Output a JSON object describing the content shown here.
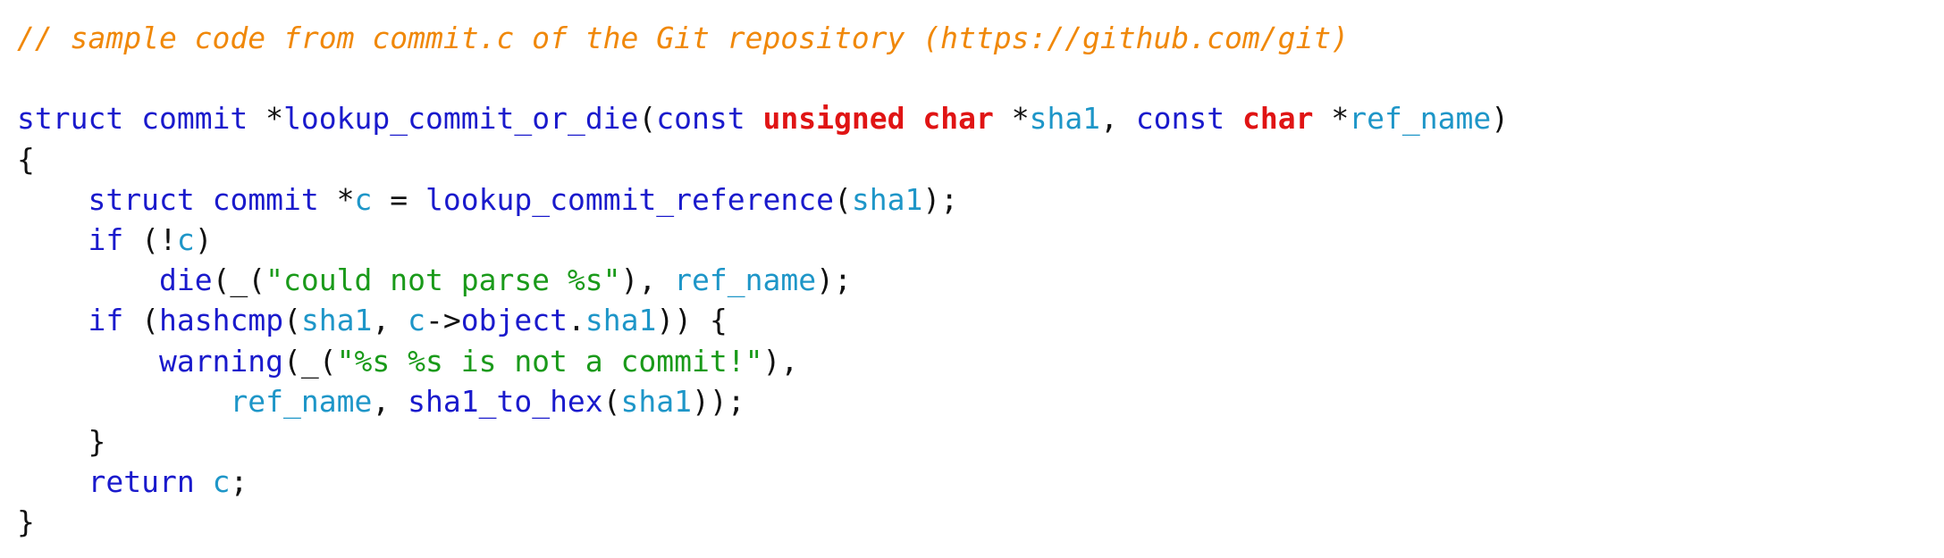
{
  "colors": {
    "comment": "#f0880a",
    "keyword": "#1a1acc",
    "type": "#e01414",
    "identifier": "#1e96c8",
    "string": "#1a9a1a",
    "plain": "#111111"
  },
  "lines": [
    [
      {
        "t": "// sample code from commit.c of the Git repository (https://github.com/git)",
        "c": "comment"
      }
    ],
    [],
    [
      {
        "t": "struct",
        "c": "keyword"
      },
      {
        "t": " "
      },
      {
        "t": "commit",
        "c": "keyword"
      },
      {
        "t": " *"
      },
      {
        "t": "lookup_commit_or_die",
        "c": "keyword"
      },
      {
        "t": "("
      },
      {
        "t": "const",
        "c": "keyword"
      },
      {
        "t": " "
      },
      {
        "t": "unsigned",
        "c": "type"
      },
      {
        "t": " "
      },
      {
        "t": "char",
        "c": "type"
      },
      {
        "t": " *"
      },
      {
        "t": "sha1",
        "c": "identifier"
      },
      {
        "t": ", "
      },
      {
        "t": "const",
        "c": "keyword"
      },
      {
        "t": " "
      },
      {
        "t": "char",
        "c": "type"
      },
      {
        "t": " *"
      },
      {
        "t": "ref_name",
        "c": "identifier"
      },
      {
        "t": ")"
      }
    ],
    [
      {
        "t": "{"
      }
    ],
    [
      {
        "t": "    "
      },
      {
        "t": "struct",
        "c": "keyword"
      },
      {
        "t": " "
      },
      {
        "t": "commit",
        "c": "keyword"
      },
      {
        "t": " *"
      },
      {
        "t": "c",
        "c": "identifier"
      },
      {
        "t": " = "
      },
      {
        "t": "lookup_commit_reference",
        "c": "keyword"
      },
      {
        "t": "("
      },
      {
        "t": "sha1",
        "c": "identifier"
      },
      {
        "t": ");"
      }
    ],
    [
      {
        "t": "    "
      },
      {
        "t": "if",
        "c": "keyword"
      },
      {
        "t": " (!"
      },
      {
        "t": "c",
        "c": "identifier"
      },
      {
        "t": ")"
      }
    ],
    [
      {
        "t": "        "
      },
      {
        "t": "die",
        "c": "keyword"
      },
      {
        "t": "(_("
      },
      {
        "t": "\"could not parse %s\"",
        "c": "string"
      },
      {
        "t": "), "
      },
      {
        "t": "ref_name",
        "c": "identifier"
      },
      {
        "t": ");"
      }
    ],
    [
      {
        "t": "    "
      },
      {
        "t": "if",
        "c": "keyword"
      },
      {
        "t": " ("
      },
      {
        "t": "hashcmp",
        "c": "keyword"
      },
      {
        "t": "("
      },
      {
        "t": "sha1",
        "c": "identifier"
      },
      {
        "t": ", "
      },
      {
        "t": "c",
        "c": "identifier"
      },
      {
        "t": "->"
      },
      {
        "t": "object",
        "c": "keyword"
      },
      {
        "t": "."
      },
      {
        "t": "sha1",
        "c": "identifier"
      },
      {
        "t": ")) {"
      }
    ],
    [
      {
        "t": "        "
      },
      {
        "t": "warning",
        "c": "keyword"
      },
      {
        "t": "(_("
      },
      {
        "t": "\"%s %s is not a commit!\"",
        "c": "string"
      },
      {
        "t": "),"
      }
    ],
    [
      {
        "t": "            "
      },
      {
        "t": "ref_name",
        "c": "identifier"
      },
      {
        "t": ", "
      },
      {
        "t": "sha1_to_hex",
        "c": "keyword"
      },
      {
        "t": "("
      },
      {
        "t": "sha1",
        "c": "identifier"
      },
      {
        "t": "));"
      }
    ],
    [
      {
        "t": "    }"
      }
    ],
    [
      {
        "t": "    "
      },
      {
        "t": "return",
        "c": "keyword"
      },
      {
        "t": " "
      },
      {
        "t": "c",
        "c": "identifier"
      },
      {
        "t": ";"
      }
    ],
    [
      {
        "t": "}"
      }
    ]
  ]
}
